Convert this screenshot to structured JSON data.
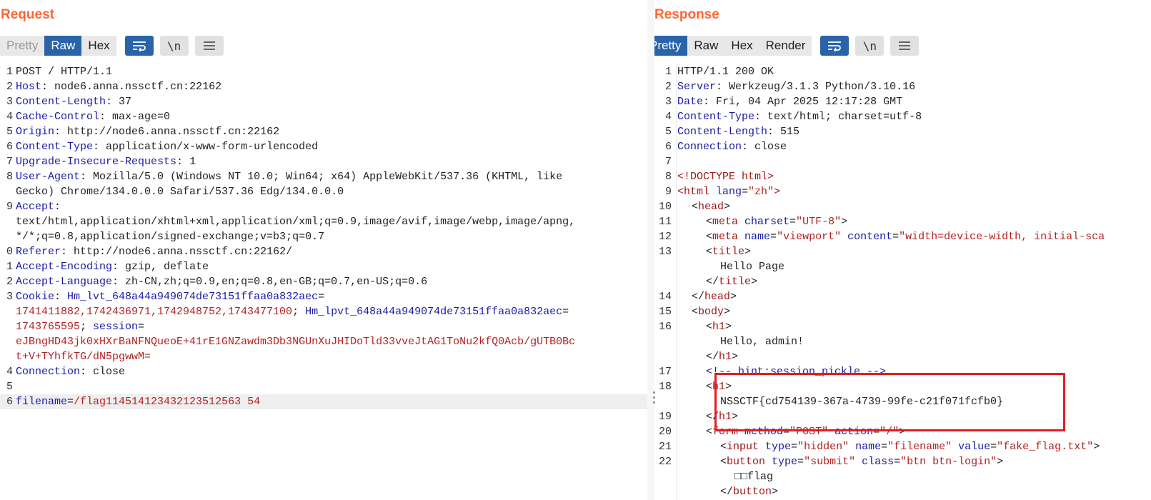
{
  "request": {
    "title": "Request",
    "tabs": [
      "Pretty",
      "Raw",
      "Hex"
    ],
    "tools": [
      "wrap-icon",
      "newline-icon",
      "menu-icon"
    ],
    "lines": [
      {
        "n": "1",
        "t": "POST / HTTP/1.1"
      },
      {
        "n": "2",
        "k": "Host",
        "v": " node6.anna.nssctf.cn:22162"
      },
      {
        "n": "3",
        "k": "Content-Length",
        "v": " 37"
      },
      {
        "n": "4",
        "k": "Cache-Control",
        "v": " max-age=0"
      },
      {
        "n": "5",
        "k": "Origin",
        "v": " http://node6.anna.nssctf.cn:22162"
      },
      {
        "n": "6",
        "k": "Content-Type",
        "v": " application/x-www-form-urlencoded"
      },
      {
        "n": "7",
        "k": "Upgrade-Insecure-Requests",
        "v": " 1"
      },
      {
        "n": "8",
        "k": "User-Agent",
        "v": " Mozilla/5.0 (Windows NT 10.0; Win64; x64) AppleWebKit/537.36 (KHTML, like"
      },
      {
        "n": "",
        "t": "Gecko) Chrome/134.0.0.0 Safari/537.36 Edg/134.0.0.0"
      },
      {
        "n": "9",
        "k": "Accept",
        "v": ""
      },
      {
        "n": "",
        "t": "text/html,application/xhtml+xml,application/xml;q=0.9,image/avif,image/webp,image/apng,"
      },
      {
        "n": "",
        "t": "*/*;q=0.8,application/signed-exchange;v=b3;q=0.7"
      },
      {
        "n": "0",
        "k": "Referer",
        "v": " http://node6.anna.nssctf.cn:22162/"
      },
      {
        "n": "1",
        "k": "Accept-Encoding",
        "v": " gzip, deflate"
      },
      {
        "n": "2",
        "k": "Accept-Language",
        "v": " zh-CN,zh;q=0.9,en;q=0.8,en-GB;q=0.7,en-US;q=0.6"
      },
      {
        "n": "3",
        "cookie1": true
      },
      {
        "n": "",
        "cookie2": true
      },
      {
        "n": "",
        "cookie3": true
      },
      {
        "n": "",
        "cookie4": true
      },
      {
        "n": "4",
        "k": "Connection",
        "v": " close"
      },
      {
        "n": "5",
        "t": ""
      },
      {
        "n": "6",
        "body": true
      }
    ],
    "cookie": {
      "label": "Cookie",
      "c1_name": "Hm_lvt_648a44a949074de73151ffaa0a832aec",
      "c1_vals": "1741411882,1742436971,1742948752,1743477100",
      "c2_name": "Hm_lpvt_648a44a949074de73151ffaa0a832aec",
      "c2_val": "1743765595",
      "c3_name": "session",
      "c3_val_a": "eJBngHD43jk0xHXrBaNFNQueoE+41rE1GNZawdm3Db3NGUnXuJHIDoTld33vveJtAG1ToNu2kfQ0Acb/gUTB0Bc",
      "c3_val_b": "t+V+TYhfkTG/dN5pgwwM="
    },
    "body": {
      "name": "filename",
      "value": "/flag114514123432123512563 54"
    }
  },
  "response": {
    "title": "Response",
    "tabs": [
      "Pretty",
      "Raw",
      "Hex",
      "Render"
    ],
    "tools": [
      "wrap-icon",
      "newline-icon",
      "menu-icon"
    ],
    "headers": [
      {
        "n": "1",
        "t": "HTTP/1.1 200 OK"
      },
      {
        "n": "2",
        "k": "Server",
        "v": " Werkzeug/3.1.3 Python/3.10.16"
      },
      {
        "n": "3",
        "k": "Date",
        "v": " Fri, 04 Apr 2025 12:17:28 GMT"
      },
      {
        "n": "4",
        "k": "Content-Type",
        "v": " text/html; charset=utf-8"
      },
      {
        "n": "5",
        "k": "Content-Length",
        "v": " 515"
      },
      {
        "n": "6",
        "k": "Connection",
        "v": " close"
      },
      {
        "n": "7",
        "t": ""
      }
    ],
    "html_lines": [
      {
        "n": "8",
        "ind": 0,
        "parts": [
          [
            "tag",
            "<!DOCTYPE html>"
          ]
        ]
      },
      {
        "n": "9",
        "ind": 0,
        "parts": [
          [
            "tag",
            "<html "
          ],
          [
            "attr",
            "lang"
          ],
          [
            "p",
            "="
          ],
          [
            "str",
            "\"zh\""
          ],
          [
            "tag",
            ">"
          ]
        ]
      },
      {
        "n": "10",
        "ind": 1,
        "parts": [
          [
            "p",
            "<"
          ],
          [
            "tag",
            "head"
          ],
          [
            "p",
            ">"
          ]
        ]
      },
      {
        "n": "11",
        "ind": 2,
        "parts": [
          [
            "p",
            "<"
          ],
          [
            "tag",
            "meta "
          ],
          [
            "attr",
            "charset"
          ],
          [
            "p",
            "="
          ],
          [
            "str",
            "\"UTF-8\""
          ],
          [
            "p",
            ">"
          ]
        ]
      },
      {
        "n": "12",
        "ind": 2,
        "parts": [
          [
            "p",
            "<"
          ],
          [
            "tag",
            "meta "
          ],
          [
            "attr",
            "name"
          ],
          [
            "p",
            "="
          ],
          [
            "str",
            "\"viewport\" "
          ],
          [
            "attr",
            "content"
          ],
          [
            "p",
            "="
          ],
          [
            "str",
            "\"width=device-width, initial-sca"
          ]
        ]
      },
      {
        "n": "13",
        "ind": 2,
        "parts": [
          [
            "p",
            "<"
          ],
          [
            "tag",
            "title"
          ],
          [
            "p",
            ">"
          ]
        ]
      },
      {
        "n": "",
        "ind": 3,
        "parts": [
          [
            "p",
            "Hello Page"
          ]
        ]
      },
      {
        "n": "",
        "ind": 2,
        "parts": [
          [
            "p",
            "</"
          ],
          [
            "tag",
            "title"
          ],
          [
            "p",
            ">"
          ]
        ]
      },
      {
        "n": "14",
        "ind": 1,
        "parts": [
          [
            "p",
            "</"
          ],
          [
            "tag",
            "head"
          ],
          [
            "p",
            ">"
          ]
        ]
      },
      {
        "n": "15",
        "ind": 1,
        "parts": [
          [
            "p",
            "<"
          ],
          [
            "tag",
            "body"
          ],
          [
            "p",
            ">"
          ]
        ]
      },
      {
        "n": "16",
        "ind": 2,
        "parts": [
          [
            "p",
            "<"
          ],
          [
            "tag",
            "h1"
          ],
          [
            "p",
            ">"
          ]
        ]
      },
      {
        "n": "",
        "ind": 3,
        "parts": [
          [
            "p",
            "Hello, admin!"
          ]
        ]
      },
      {
        "n": "",
        "ind": 2,
        "parts": [
          [
            "p",
            "</"
          ],
          [
            "tag",
            "h1"
          ],
          [
            "p",
            ">"
          ]
        ]
      },
      {
        "n": "17",
        "ind": 2,
        "parts": [
          [
            "cmt",
            "<!-- hint:session_pickle -->"
          ]
        ]
      },
      {
        "n": "18",
        "ind": 2,
        "parts": [
          [
            "p",
            "<"
          ],
          [
            "tag",
            "h1"
          ],
          [
            "p",
            ">"
          ]
        ]
      },
      {
        "n": "",
        "ind": 3,
        "parts": [
          [
            "p",
            "NSSCTF{cd754139-367a-4739-99fe-c21f071fcfb0}"
          ]
        ]
      },
      {
        "n": "19",
        "ind": 2,
        "parts": [
          [
            "p",
            "</"
          ],
          [
            "tag",
            "h1"
          ],
          [
            "p",
            ">"
          ]
        ]
      },
      {
        "n": "20",
        "ind": 2,
        "parts": [
          [
            "p",
            "<"
          ],
          [
            "tag",
            "form "
          ],
          [
            "attr",
            "method"
          ],
          [
            "p",
            "="
          ],
          [
            "str",
            "\"POST\" "
          ],
          [
            "attr",
            "action"
          ],
          [
            "p",
            "="
          ],
          [
            "str",
            "\"/\""
          ],
          [
            "p",
            ">"
          ]
        ]
      },
      {
        "n": "21",
        "ind": 3,
        "parts": [
          [
            "p",
            "<"
          ],
          [
            "tag",
            "input "
          ],
          [
            "attr",
            "type"
          ],
          [
            "p",
            "="
          ],
          [
            "str",
            "\"hidden\" "
          ],
          [
            "attr",
            "name"
          ],
          [
            "p",
            "="
          ],
          [
            "str",
            "\"filename\" "
          ],
          [
            "attr",
            "value"
          ],
          [
            "p",
            "="
          ],
          [
            "str",
            "\"fake_flag.txt\""
          ],
          [
            "p",
            ">"
          ]
        ]
      },
      {
        "n": "22",
        "ind": 3,
        "parts": [
          [
            "p",
            "<"
          ],
          [
            "tag",
            "button "
          ],
          [
            "attr",
            "type"
          ],
          [
            "p",
            "="
          ],
          [
            "str",
            "\"submit\" "
          ],
          [
            "attr",
            "class"
          ],
          [
            "p",
            "="
          ],
          [
            "str",
            "\"btn btn-login\""
          ],
          [
            "p",
            ">"
          ]
        ]
      },
      {
        "n": "",
        "ind": 4,
        "parts": [
          [
            "p",
            "□□flag"
          ]
        ]
      },
      {
        "n": "",
        "ind": 3,
        "parts": [
          [
            "p",
            "</"
          ],
          [
            "tag",
            "button"
          ],
          [
            "p",
            ">"
          ]
        ]
      }
    ]
  }
}
